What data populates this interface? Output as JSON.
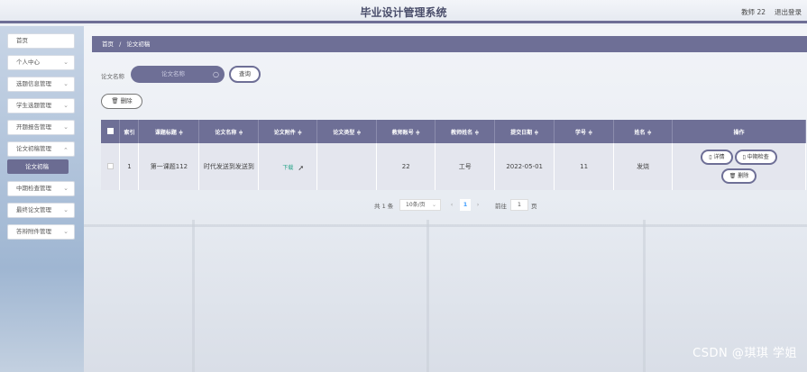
{
  "header": {
    "title": "毕业设计管理系统",
    "user": "教师 22",
    "logout": "退出登录"
  },
  "sidebar": {
    "items": [
      {
        "label": "首页",
        "has_chevron": false
      },
      {
        "label": "个人中心",
        "has_chevron": true
      },
      {
        "label": "选题信息管理",
        "has_chevron": true
      },
      {
        "label": "学生选题管理",
        "has_chevron": true
      },
      {
        "label": "开题报告管理",
        "has_chevron": true
      },
      {
        "label": "论文初稿管理",
        "has_chevron": true
      },
      {
        "label": "中期检查管理",
        "has_chevron": true
      },
      {
        "label": "最终论文管理",
        "has_chevron": true
      },
      {
        "label": "答辩附件管理",
        "has_chevron": true
      }
    ],
    "active_sub": "论文初稿",
    "chevron_glyph": "⌄"
  },
  "breadcrumb": {
    "home": "首页",
    "sep": "/",
    "current": "论文初稿"
  },
  "search": {
    "label": "论文名称",
    "placeholder": "论文名称",
    "query_button": "查询"
  },
  "toolbar": {
    "delete_button": "删除"
  },
  "table": {
    "headers": [
      "索引",
      "课题标题",
      "论文名称",
      "论文附件",
      "论文类型",
      "教师账号",
      "教师姓名",
      "提交日期",
      "学号",
      "姓名",
      "操作"
    ],
    "sort_glyph": "≑",
    "rows": [
      {
        "index": "1",
        "topic_title": "第一课题112",
        "paper_name": "时代发送到发送到",
        "attachment": "下载",
        "paper_type": "",
        "teacher_account": "22",
        "teacher_name": "工号",
        "submit_date": "2022-05-01",
        "student_no": "11",
        "student_name": "发烧",
        "actions": {
          "detail": "详情",
          "midterm_check": "中期检查",
          "delete": "删除"
        }
      }
    ]
  },
  "pagination": {
    "total": "共 1 条",
    "page_size": "10条/页",
    "prev": "‹",
    "current_page": "1",
    "next": "›",
    "goto_label": "前往",
    "goto_value": "1",
    "page_suffix": "页"
  },
  "watermark": "CSDN @琪琪 学姐",
  "colors": {
    "accent": "#6e6f96",
    "link": "#2aa58a"
  }
}
